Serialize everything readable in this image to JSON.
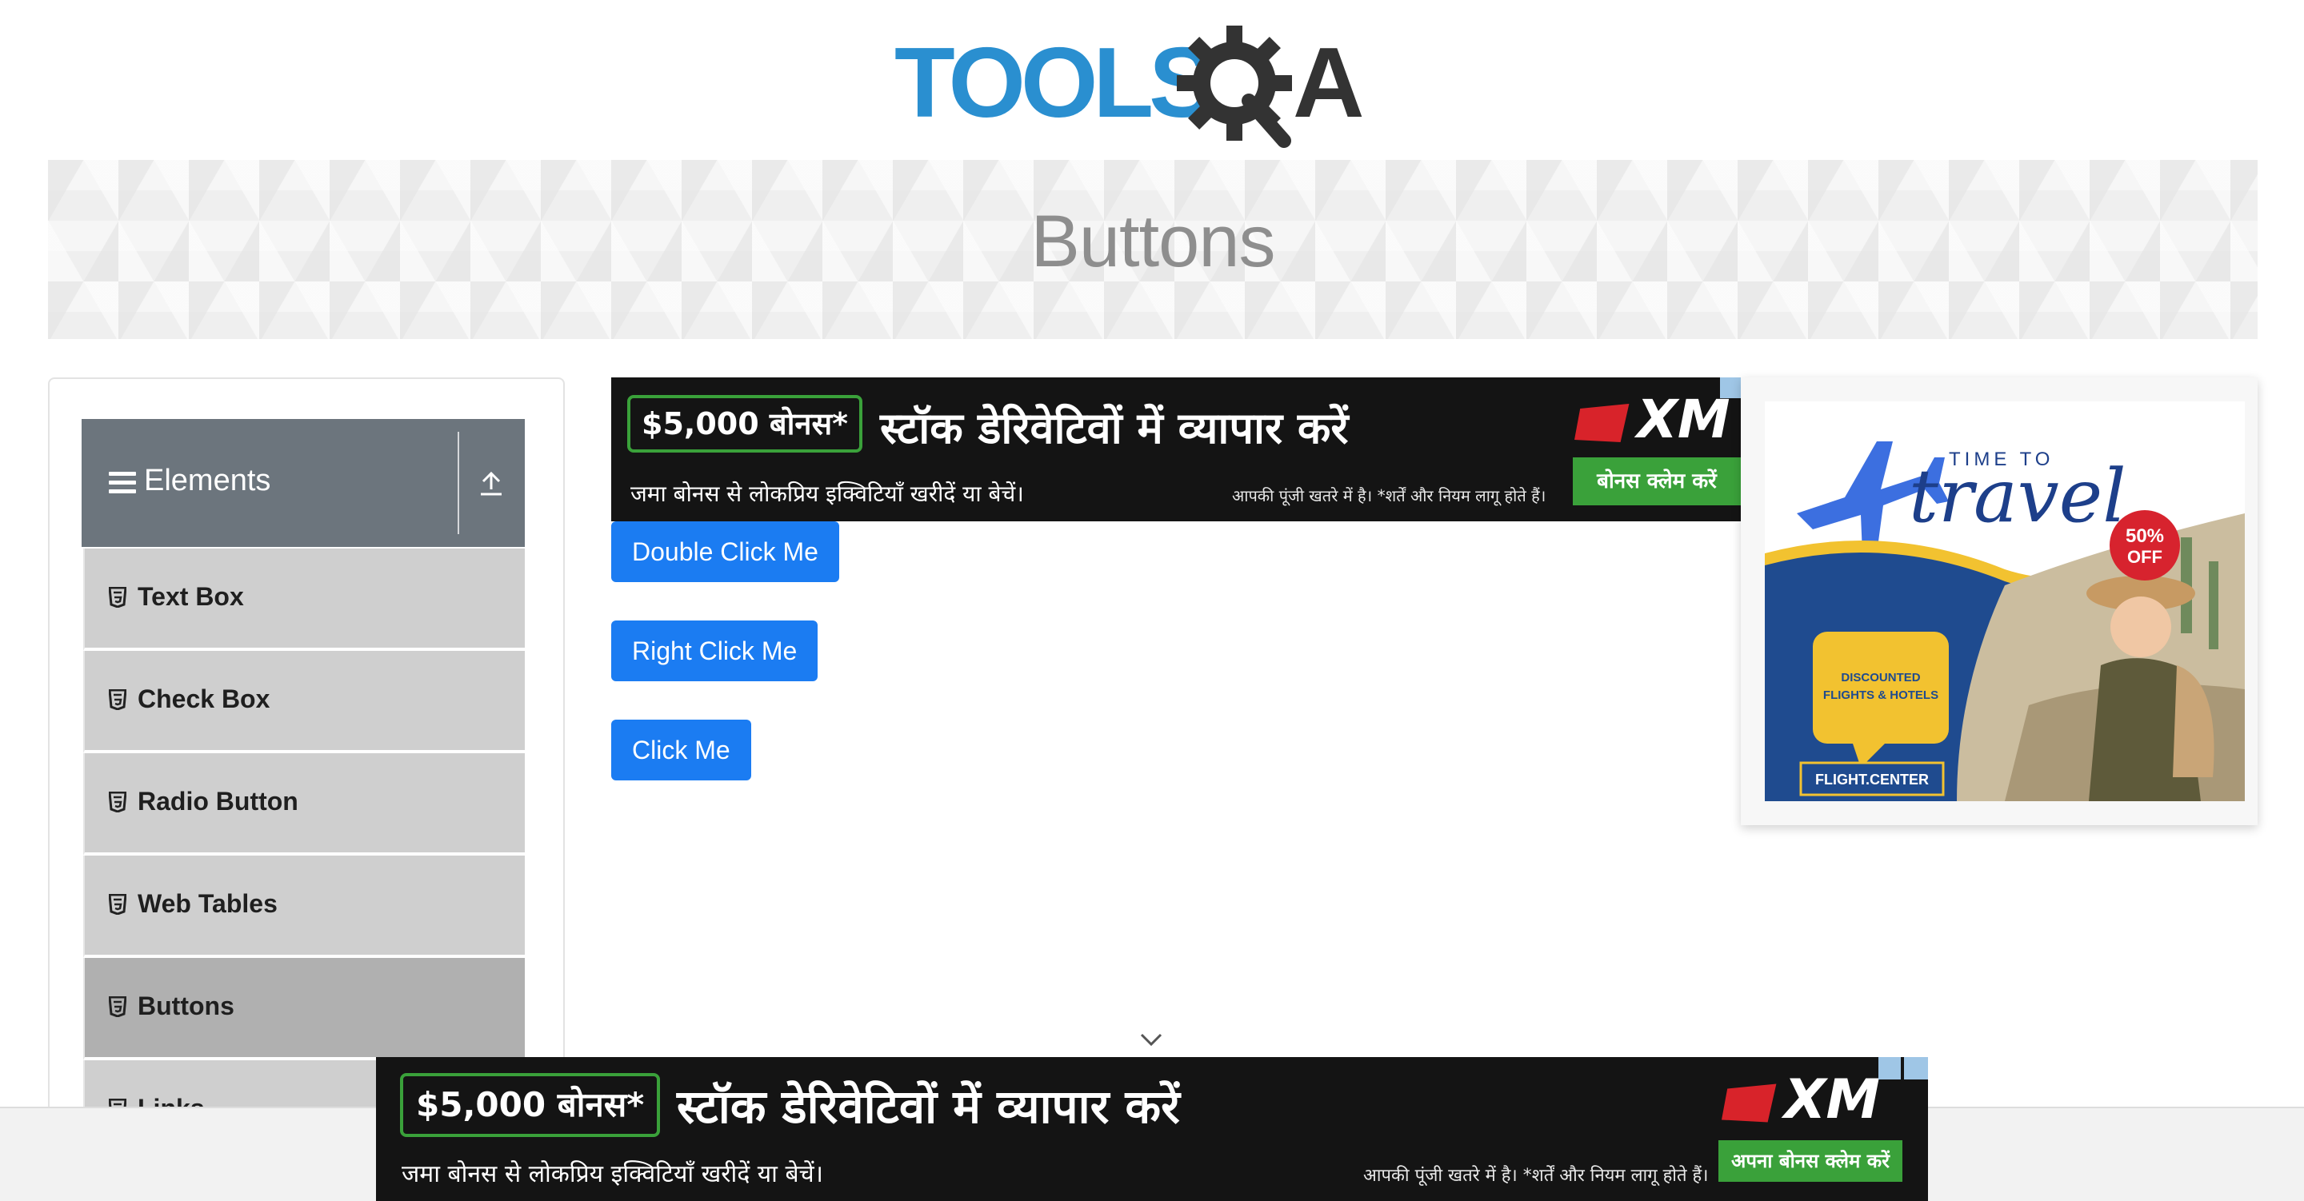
{
  "header": {
    "logo_text_tools": "TOOLS",
    "logo_text_qa": "QA"
  },
  "banner": {
    "title": "Buttons"
  },
  "sidebar": {
    "group_title": "Elements",
    "group_icon": "hamburger-icon",
    "collapse_icon": "upload-arrow-icon",
    "items": [
      {
        "label": "Text Box",
        "icon": "html5-icon",
        "active": false
      },
      {
        "label": "Check Box",
        "icon": "html5-icon",
        "active": false
      },
      {
        "label": "Radio Button",
        "icon": "html5-icon",
        "active": false
      },
      {
        "label": "Web Tables",
        "icon": "html5-icon",
        "active": false
      },
      {
        "label": "Buttons",
        "icon": "html5-icon",
        "active": true
      },
      {
        "label": "Links",
        "icon": "html5-icon",
        "active": false
      }
    ]
  },
  "main": {
    "buttons": {
      "double_click": "Double Click Me",
      "right_click": "Right Click Me",
      "click": "Click Me"
    }
  },
  "ad_top": {
    "bonus": "$5,000 बोनस*",
    "headline": "स्टॉक डेरिवेटिवों में व्यापार करें",
    "subline": "जमा बोनस से लोकप्रिय इक्विटियाँ खरीदें या बेचें।",
    "risk": "आपकी पूंजी खतरे में है। *शर्तें और नियम लागू होते हैं।",
    "brand": "XM",
    "cta": "बोनस क्लेम करें"
  },
  "ad_bottom": {
    "bonus": "$5,000 बोनस*",
    "headline": "स्टॉक डेरिवेटिवों में व्यापार करें",
    "subline": "जमा बोनस से लोकप्रिय इक्विटियाँ खरीदें या बेचें।",
    "risk": "आपकी पूंजी खतरे में है। *शर्तें और नियम लागू होते हैं।",
    "brand": "XM",
    "cta": "अपना बोनस क्लेम करें"
  },
  "travel_ad": {
    "close": "✕",
    "time_to": "TIME TO",
    "travel": "travel",
    "discount_pct": "50%",
    "discount_off": "OFF",
    "bubble_line1": "DISCOUNTED",
    "bubble_line2": "FLIGHTS & HOTELS",
    "brand": "FLIGHT.CENTER"
  },
  "colors": {
    "primary_button": "#1b7cf2",
    "sidebar_header": "#6c757d",
    "menu_item": "#cfcfcf",
    "menu_item_active": "#b0b0b0",
    "logo_blue": "#2a8fd0",
    "logo_dark": "#333333",
    "ad_green": "#3aa13a",
    "xm_red": "#d8232a"
  }
}
